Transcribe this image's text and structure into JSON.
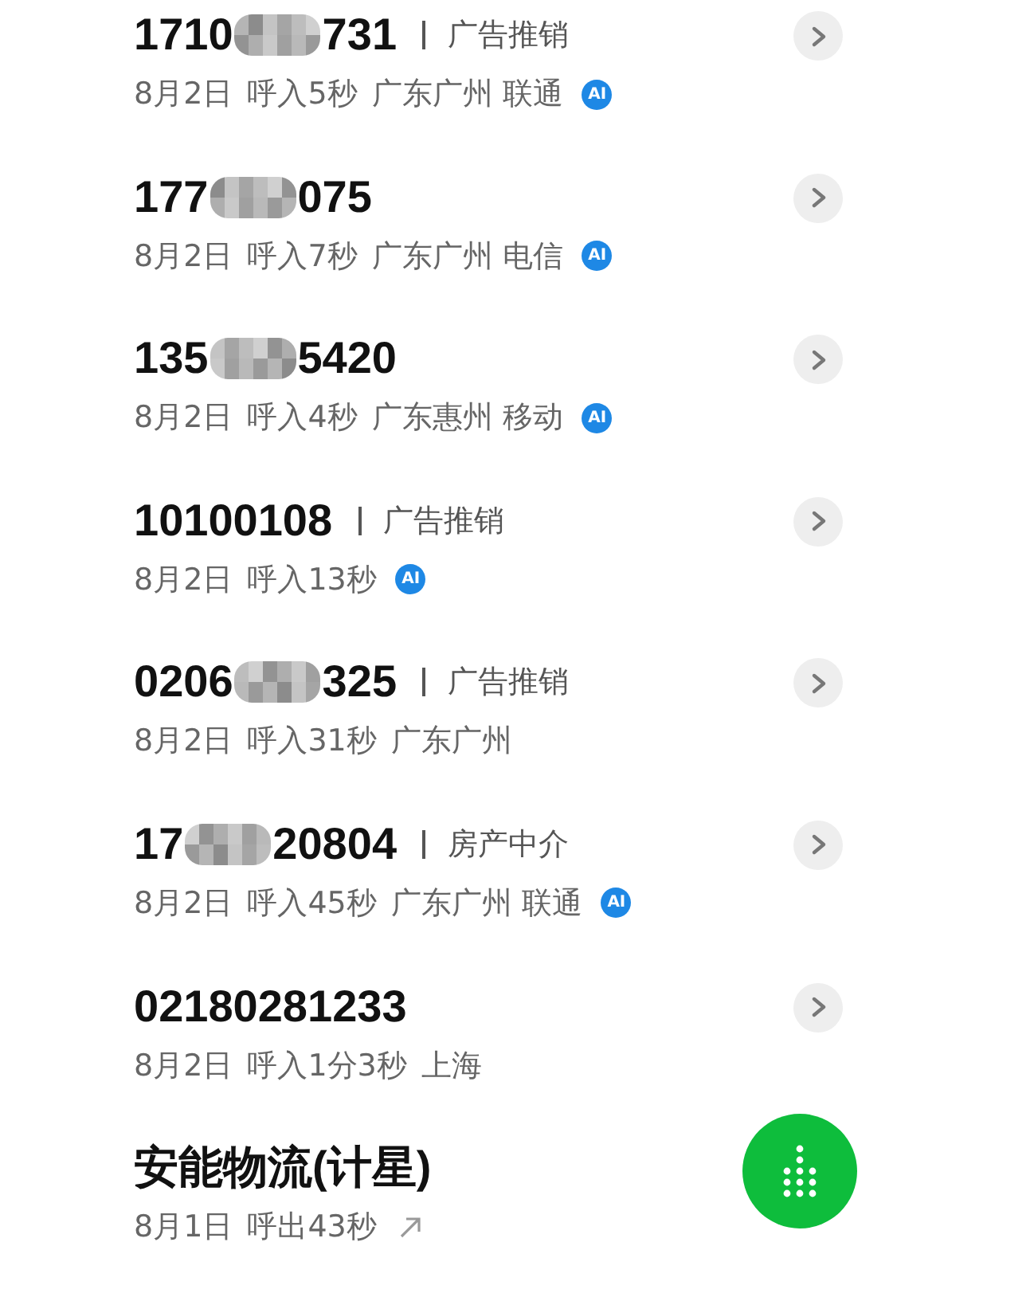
{
  "calls": [
    {
      "number_start": "1710",
      "masked": true,
      "number_end": "731",
      "tag": "广告推销",
      "date": "8月2日",
      "call": "呼入5秒",
      "location": "广东广州 联通",
      "ai_badge": "AI",
      "outgoing": false,
      "chevron": true
    },
    {
      "number_start": "177",
      "masked": true,
      "number_end": "075",
      "date": "8月2日",
      "call": "呼入7秒",
      "location": "广东广州 电信",
      "ai_badge": "AI",
      "outgoing": false,
      "chevron": true
    },
    {
      "number_start": "135",
      "masked": true,
      "number_end": "5420",
      "date": "8月2日",
      "call": "呼入4秒",
      "location": "广东惠州 移动",
      "ai_badge": "AI",
      "outgoing": false,
      "chevron": true
    },
    {
      "number_start": "10100108",
      "masked": false,
      "tag": "广告推销",
      "date": "8月2日",
      "call": "呼入13秒",
      "ai_badge": "AI",
      "outgoing": false,
      "chevron": true
    },
    {
      "number_start": "0206",
      "masked": true,
      "number_end": "325",
      "tag": "广告推销",
      "date": "8月2日",
      "call": "呼入31秒",
      "location": "广东广州",
      "outgoing": false,
      "chevron": true
    },
    {
      "number_start": "17",
      "masked": true,
      "number_end": "20804",
      "tag": "房产中介",
      "date": "8月2日",
      "call": "呼入45秒",
      "location": "广东广州 联通",
      "ai_badge": "AI",
      "outgoing": false,
      "chevron": true
    },
    {
      "number_start": "02180281233",
      "masked": false,
      "date": "8月2日",
      "call": "呼入1分3秒",
      "location": "上海",
      "outgoing": false,
      "chevron": true
    },
    {
      "number_start": "安能物流(计星)",
      "masked": false,
      "date": "8月1日",
      "call": "呼出43秒",
      "outgoing": true,
      "chevron": false
    }
  ],
  "dialpad_button": true
}
